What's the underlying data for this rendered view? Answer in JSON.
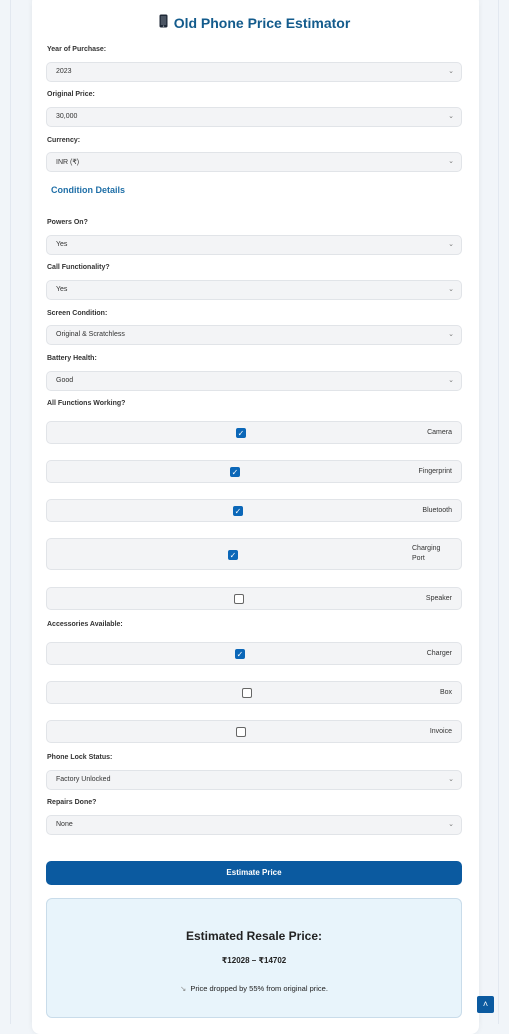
{
  "title": "Old Phone Price Estimator",
  "title_icon": "mobile-phone-icon",
  "fields": {
    "year": {
      "label": "Year of Purchase:",
      "value": "2023"
    },
    "price": {
      "label": "Original Price:",
      "value": "30,000"
    },
    "currency": {
      "label": "Currency:",
      "value": "INR (₹)"
    },
    "powers_on": {
      "label": "Powers On?",
      "value": "Yes"
    },
    "call": {
      "label": "Call Functionality?",
      "value": "Yes"
    },
    "screen": {
      "label": "Screen Condition:",
      "value": "Original & Scratchless"
    },
    "battery": {
      "label": "Battery Health:",
      "value": "Good"
    },
    "lock": {
      "label": "Phone Lock Status:",
      "value": "Factory Unlocked"
    },
    "repairs": {
      "label": "Repairs Done?",
      "value": "None"
    }
  },
  "condition_heading": "Condition Details",
  "functions": {
    "label": "All Functions Working?",
    "items": [
      {
        "label": "Camera",
        "checked": true
      },
      {
        "label": "Fingerprint",
        "checked": true
      },
      {
        "label": "Bluetooth",
        "checked": true
      },
      {
        "label": "Charging Port",
        "checked": true
      },
      {
        "label": "Speaker",
        "checked": false
      }
    ]
  },
  "accessories": {
    "label": "Accessories Available:",
    "items": [
      {
        "label": "Charger",
        "checked": true
      },
      {
        "label": "Box",
        "checked": false
      },
      {
        "label": "Invoice",
        "checked": false
      }
    ]
  },
  "estimate_button": "Estimate Price",
  "result": {
    "heading": "Estimated Resale Price:",
    "range": "₹12028 – ₹14702",
    "trend_icon": "chart-down-icon",
    "note": "Price dropped by 55% from original price."
  },
  "colors": {
    "accent": "#0b5aa0",
    "title": "#135b8c",
    "result_bg": "#e8f4fb"
  }
}
